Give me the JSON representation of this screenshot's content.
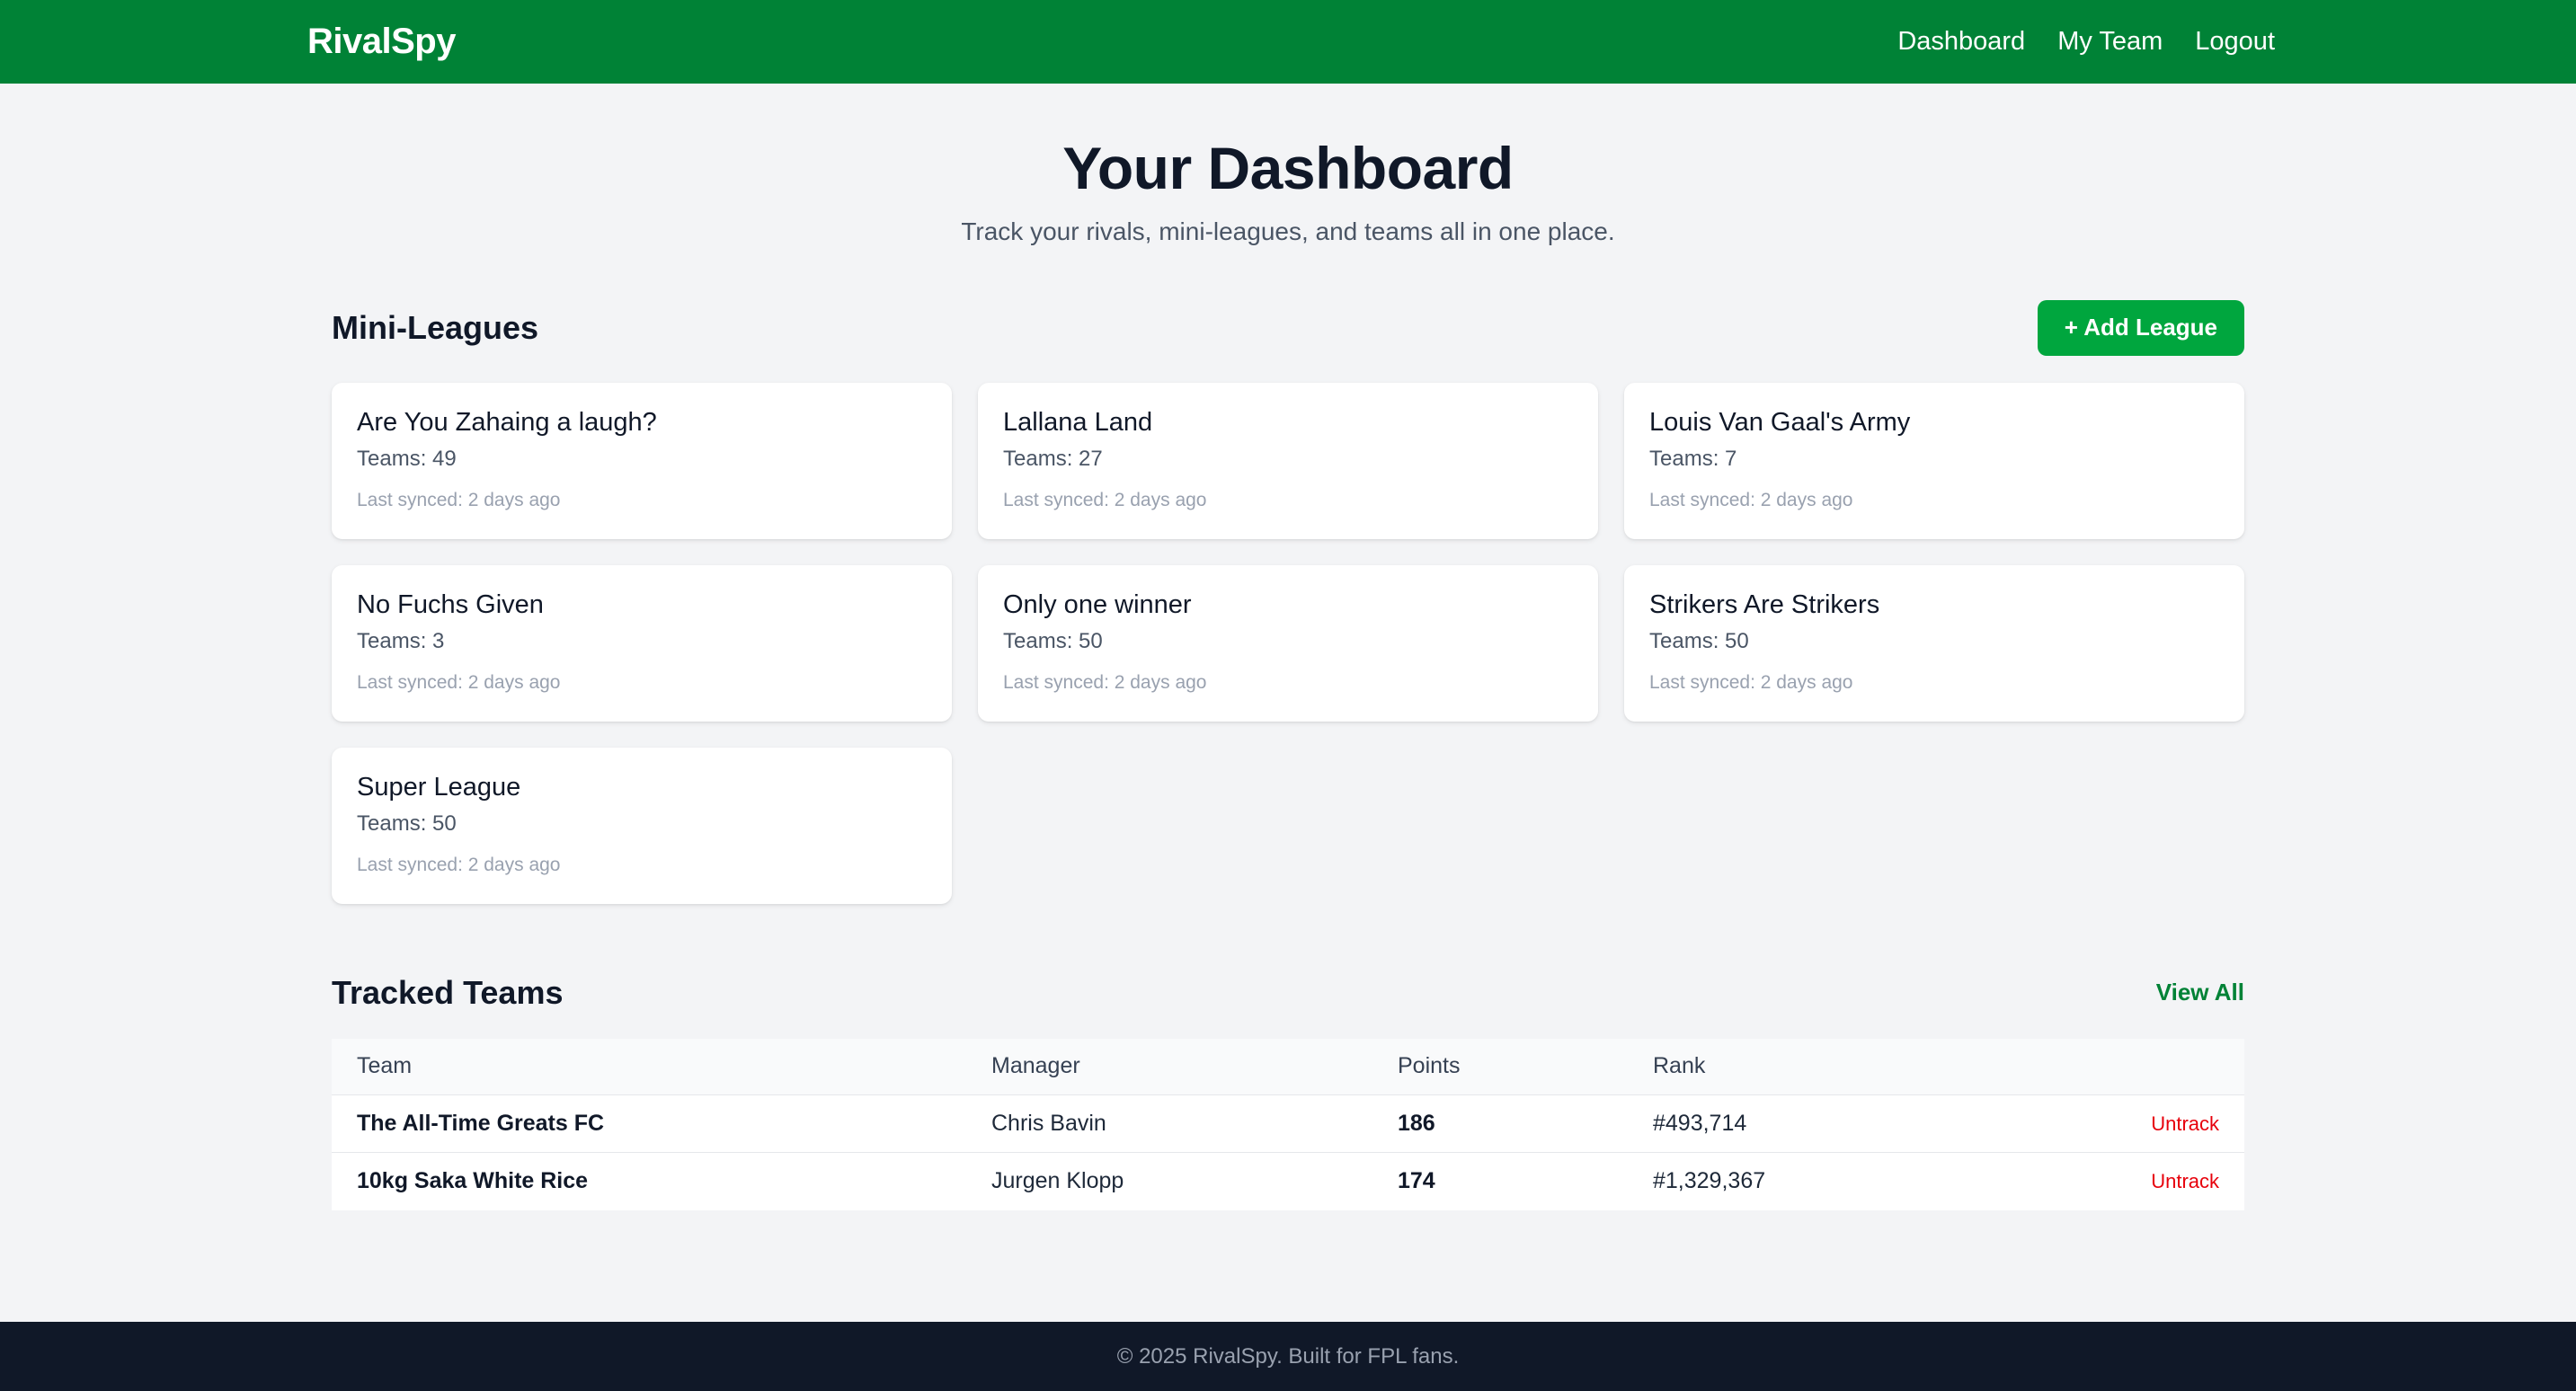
{
  "nav": {
    "brand": "RivalSpy",
    "links": [
      "Dashboard",
      "My Team",
      "Logout"
    ]
  },
  "hero": {
    "title": "Your Dashboard",
    "subtitle": "Track your rivals, mini-leagues, and teams all in one place."
  },
  "leagues": {
    "heading": "Mini-Leagues",
    "add_label": "+ Add League",
    "items": [
      {
        "name": "Are You Zahaing a laugh?",
        "teams": "Teams: 49",
        "synced": "Last synced: 2 days ago"
      },
      {
        "name": "Lallana Land",
        "teams": "Teams: 27",
        "synced": "Last synced: 2 days ago"
      },
      {
        "name": "Louis Van Gaal's Army",
        "teams": "Teams: 7",
        "synced": "Last synced: 2 days ago"
      },
      {
        "name": "No Fuchs Given",
        "teams": "Teams: 3",
        "synced": "Last synced: 2 days ago"
      },
      {
        "name": "Only one winner",
        "teams": "Teams: 50",
        "synced": "Last synced: 2 days ago"
      },
      {
        "name": "Strikers Are Strikers",
        "teams": "Teams: 50",
        "synced": "Last synced: 2 days ago"
      },
      {
        "name": "Super League",
        "teams": "Teams: 50",
        "synced": "Last synced: 2 days ago"
      }
    ]
  },
  "tracked": {
    "heading": "Tracked Teams",
    "view_all": "View All",
    "columns": [
      "Team",
      "Manager",
      "Points",
      "Rank"
    ],
    "rows": [
      {
        "team": "The All-Time Greats FC",
        "manager": "Chris Bavin",
        "points": "186",
        "rank": "#493,714",
        "action": "Untrack"
      },
      {
        "team": "10kg Saka White Rice",
        "manager": "Jurgen Klopp",
        "points": "174",
        "rank": "#1,329,367",
        "action": "Untrack"
      }
    ]
  },
  "footer": {
    "text": "© 2025 RivalSpy. Built for FPL fans."
  },
  "colors": {
    "nav_bg": "#008236",
    "accent": "#00a63e",
    "danger": "#e7000b",
    "footer_bg": "#101828"
  }
}
